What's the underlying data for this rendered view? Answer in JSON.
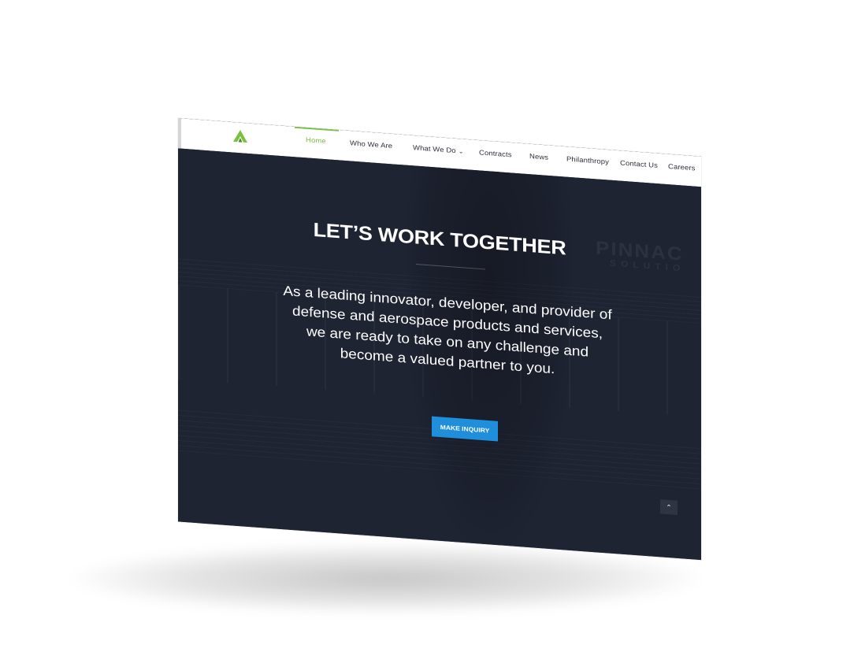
{
  "nav": {
    "items": [
      {
        "label": "Home",
        "active": true
      },
      {
        "label": "Who We Are",
        "active": false
      },
      {
        "label": "What We Do",
        "active": false,
        "has_dropdown": true
      },
      {
        "label": "Contracts",
        "active": false
      },
      {
        "label": "News",
        "active": false
      },
      {
        "label": "Philanthropy",
        "active": false
      },
      {
        "label": "Contact Us",
        "active": false
      },
      {
        "label": "Careers",
        "active": false
      }
    ],
    "dropdown_icon": "chevron-down-icon",
    "logo_icon": "triangle-logo-icon"
  },
  "hero": {
    "title": "LET’S WORK TOGETHER",
    "text": "As a leading innovator, developer, and provider of defense and aerospace products and services, we are ready to take on any challenge and become a valued partner to you.",
    "cta_label": "MAKE INQUIRY",
    "background_sign": "PINNAC",
    "background_sign_sub": "SOLUTIO"
  },
  "scroll_top_icon": "chevron-up-icon",
  "colors": {
    "accent_green": "#7ac143",
    "cta_blue": "#1f8fdb",
    "hero_bg": "#1f2433",
    "nav_bg": "#ffffff"
  }
}
